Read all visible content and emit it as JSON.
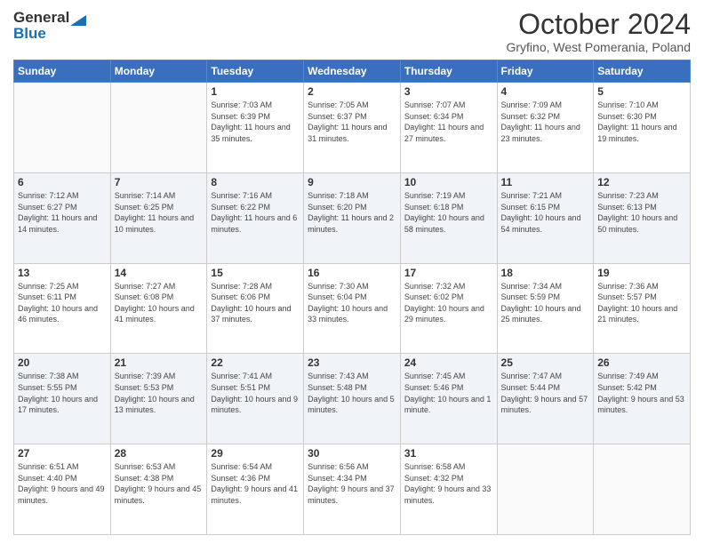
{
  "logo": {
    "general": "General",
    "blue": "Blue"
  },
  "title": "October 2024",
  "location": "Gryfino, West Pomerania, Poland",
  "weekdays": [
    "Sunday",
    "Monday",
    "Tuesday",
    "Wednesday",
    "Thursday",
    "Friday",
    "Saturday"
  ],
  "weeks": [
    [
      {
        "day": "",
        "sunrise": "",
        "sunset": "",
        "daylight": ""
      },
      {
        "day": "",
        "sunrise": "",
        "sunset": "",
        "daylight": ""
      },
      {
        "day": "1",
        "sunrise": "Sunrise: 7:03 AM",
        "sunset": "Sunset: 6:39 PM",
        "daylight": "Daylight: 11 hours and 35 minutes."
      },
      {
        "day": "2",
        "sunrise": "Sunrise: 7:05 AM",
        "sunset": "Sunset: 6:37 PM",
        "daylight": "Daylight: 11 hours and 31 minutes."
      },
      {
        "day": "3",
        "sunrise": "Sunrise: 7:07 AM",
        "sunset": "Sunset: 6:34 PM",
        "daylight": "Daylight: 11 hours and 27 minutes."
      },
      {
        "day": "4",
        "sunrise": "Sunrise: 7:09 AM",
        "sunset": "Sunset: 6:32 PM",
        "daylight": "Daylight: 11 hours and 23 minutes."
      },
      {
        "day": "5",
        "sunrise": "Sunrise: 7:10 AM",
        "sunset": "Sunset: 6:30 PM",
        "daylight": "Daylight: 11 hours and 19 minutes."
      }
    ],
    [
      {
        "day": "6",
        "sunrise": "Sunrise: 7:12 AM",
        "sunset": "Sunset: 6:27 PM",
        "daylight": "Daylight: 11 hours and 14 minutes."
      },
      {
        "day": "7",
        "sunrise": "Sunrise: 7:14 AM",
        "sunset": "Sunset: 6:25 PM",
        "daylight": "Daylight: 11 hours and 10 minutes."
      },
      {
        "day": "8",
        "sunrise": "Sunrise: 7:16 AM",
        "sunset": "Sunset: 6:22 PM",
        "daylight": "Daylight: 11 hours and 6 minutes."
      },
      {
        "day": "9",
        "sunrise": "Sunrise: 7:18 AM",
        "sunset": "Sunset: 6:20 PM",
        "daylight": "Daylight: 11 hours and 2 minutes."
      },
      {
        "day": "10",
        "sunrise": "Sunrise: 7:19 AM",
        "sunset": "Sunset: 6:18 PM",
        "daylight": "Daylight: 10 hours and 58 minutes."
      },
      {
        "day": "11",
        "sunrise": "Sunrise: 7:21 AM",
        "sunset": "Sunset: 6:15 PM",
        "daylight": "Daylight: 10 hours and 54 minutes."
      },
      {
        "day": "12",
        "sunrise": "Sunrise: 7:23 AM",
        "sunset": "Sunset: 6:13 PM",
        "daylight": "Daylight: 10 hours and 50 minutes."
      }
    ],
    [
      {
        "day": "13",
        "sunrise": "Sunrise: 7:25 AM",
        "sunset": "Sunset: 6:11 PM",
        "daylight": "Daylight: 10 hours and 46 minutes."
      },
      {
        "day": "14",
        "sunrise": "Sunrise: 7:27 AM",
        "sunset": "Sunset: 6:08 PM",
        "daylight": "Daylight: 10 hours and 41 minutes."
      },
      {
        "day": "15",
        "sunrise": "Sunrise: 7:28 AM",
        "sunset": "Sunset: 6:06 PM",
        "daylight": "Daylight: 10 hours and 37 minutes."
      },
      {
        "day": "16",
        "sunrise": "Sunrise: 7:30 AM",
        "sunset": "Sunset: 6:04 PM",
        "daylight": "Daylight: 10 hours and 33 minutes."
      },
      {
        "day": "17",
        "sunrise": "Sunrise: 7:32 AM",
        "sunset": "Sunset: 6:02 PM",
        "daylight": "Daylight: 10 hours and 29 minutes."
      },
      {
        "day": "18",
        "sunrise": "Sunrise: 7:34 AM",
        "sunset": "Sunset: 5:59 PM",
        "daylight": "Daylight: 10 hours and 25 minutes."
      },
      {
        "day": "19",
        "sunrise": "Sunrise: 7:36 AM",
        "sunset": "Sunset: 5:57 PM",
        "daylight": "Daylight: 10 hours and 21 minutes."
      }
    ],
    [
      {
        "day": "20",
        "sunrise": "Sunrise: 7:38 AM",
        "sunset": "Sunset: 5:55 PM",
        "daylight": "Daylight: 10 hours and 17 minutes."
      },
      {
        "day": "21",
        "sunrise": "Sunrise: 7:39 AM",
        "sunset": "Sunset: 5:53 PM",
        "daylight": "Daylight: 10 hours and 13 minutes."
      },
      {
        "day": "22",
        "sunrise": "Sunrise: 7:41 AM",
        "sunset": "Sunset: 5:51 PM",
        "daylight": "Daylight: 10 hours and 9 minutes."
      },
      {
        "day": "23",
        "sunrise": "Sunrise: 7:43 AM",
        "sunset": "Sunset: 5:48 PM",
        "daylight": "Daylight: 10 hours and 5 minutes."
      },
      {
        "day": "24",
        "sunrise": "Sunrise: 7:45 AM",
        "sunset": "Sunset: 5:46 PM",
        "daylight": "Daylight: 10 hours and 1 minute."
      },
      {
        "day": "25",
        "sunrise": "Sunrise: 7:47 AM",
        "sunset": "Sunset: 5:44 PM",
        "daylight": "Daylight: 9 hours and 57 minutes."
      },
      {
        "day": "26",
        "sunrise": "Sunrise: 7:49 AM",
        "sunset": "Sunset: 5:42 PM",
        "daylight": "Daylight: 9 hours and 53 minutes."
      }
    ],
    [
      {
        "day": "27",
        "sunrise": "Sunrise: 6:51 AM",
        "sunset": "Sunset: 4:40 PM",
        "daylight": "Daylight: 9 hours and 49 minutes."
      },
      {
        "day": "28",
        "sunrise": "Sunrise: 6:53 AM",
        "sunset": "Sunset: 4:38 PM",
        "daylight": "Daylight: 9 hours and 45 minutes."
      },
      {
        "day": "29",
        "sunrise": "Sunrise: 6:54 AM",
        "sunset": "Sunset: 4:36 PM",
        "daylight": "Daylight: 9 hours and 41 minutes."
      },
      {
        "day": "30",
        "sunrise": "Sunrise: 6:56 AM",
        "sunset": "Sunset: 4:34 PM",
        "daylight": "Daylight: 9 hours and 37 minutes."
      },
      {
        "day": "31",
        "sunrise": "Sunrise: 6:58 AM",
        "sunset": "Sunset: 4:32 PM",
        "daylight": "Daylight: 9 hours and 33 minutes."
      },
      {
        "day": "",
        "sunrise": "",
        "sunset": "",
        "daylight": ""
      },
      {
        "day": "",
        "sunrise": "",
        "sunset": "",
        "daylight": ""
      }
    ]
  ]
}
